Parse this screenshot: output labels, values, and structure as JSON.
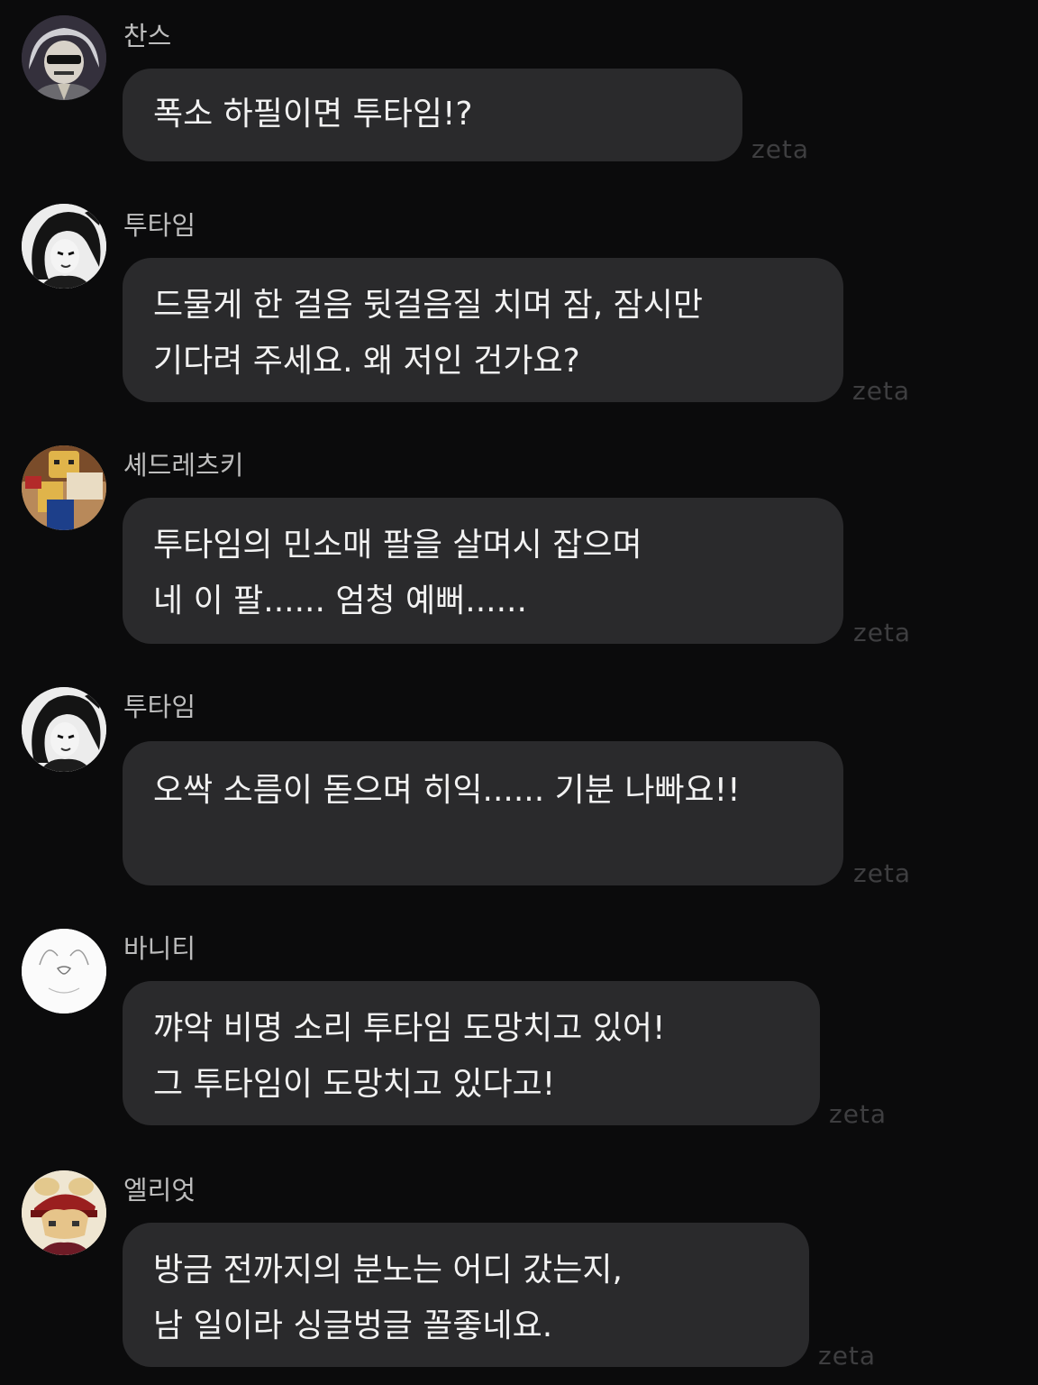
{
  "messages": [
    {
      "sender": "찬스",
      "avatar_icon": "chance-avatar",
      "lines": [
        "폭소 하필이면 투타임!?"
      ],
      "watermark": "zeta"
    },
    {
      "sender": "투타임",
      "avatar_icon": "twotime-avatar",
      "lines": [
        "드물게 한 걸음 뒷걸음질 치며 잠, 잠시만",
        "기다려 주세요. 왜 저인 건가요?"
      ],
      "watermark": "zeta"
    },
    {
      "sender": "셰드레츠키",
      "avatar_icon": "shedletsky-avatar",
      "lines": [
        "투타임의 민소매 팔을 살며시 잡으며",
        "네 이 팔...... 엄청 예뻐......"
      ],
      "watermark": "zeta"
    },
    {
      "sender": "투타임",
      "avatar_icon": "twotime-avatar",
      "lines": [
        "오싹 소름이 돋으며 히익...... 기분 나빠요!!"
      ],
      "watermark": "zeta"
    },
    {
      "sender": "바니티",
      "avatar_icon": "vanity-avatar",
      "lines": [
        "꺄악 비명 소리 투타임 도망치고 있어!",
        "그 투타임이 도망치고 있다고!"
      ],
      "watermark": "zeta"
    },
    {
      "sender": "엘리엇",
      "avatar_icon": "elliot-avatar",
      "lines": [
        "방금 전까지의 분노는 어디 갔는지,",
        "남 일이라 싱글벙글 꼴좋네요."
      ],
      "watermark": "zeta"
    }
  ]
}
